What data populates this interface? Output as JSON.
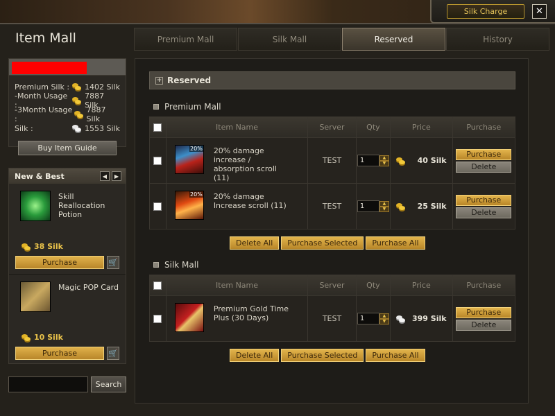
{
  "top": {
    "silk_charge": "Silk Charge",
    "close": "✕"
  },
  "app": {
    "title": "Item Mall"
  },
  "tabs": [
    {
      "label": "Premium Mall",
      "active": false
    },
    {
      "label": "Silk Mall",
      "active": false
    },
    {
      "label": "Reserved",
      "active": true
    },
    {
      "label": "History",
      "active": false
    }
  ],
  "account": {
    "rows": [
      {
        "label": "Premium Silk :",
        "value": "1402 Silk",
        "coin": "gold"
      },
      {
        "label": "-Month Usage :",
        "value": "7887 Silk",
        "coin": "gold"
      },
      {
        "label": "-3Month Usage :",
        "value": "7887 Silk",
        "coin": "gold"
      },
      {
        "label": "Silk :",
        "value": "1553 Silk",
        "coin": "silver"
      }
    ],
    "guide_button": "Buy Item Guide"
  },
  "new_best": {
    "title": "New & Best",
    "prev": "◀",
    "next": "▶",
    "items": [
      {
        "name": "Skill Reallocation Potion",
        "price": "38 Silk",
        "purchase": "Purchase",
        "icon": "green-orb-icon"
      },
      {
        "name": "Magic POP Card",
        "price": "10 Silk",
        "purchase": "Purchase",
        "icon": "magic-card-icon"
      }
    ],
    "cart": "🛒"
  },
  "search": {
    "placeholder": "",
    "button": "Search"
  },
  "reserved": {
    "header": "Reserved",
    "plus": "+",
    "columns": [
      "Item Name",
      "Server",
      "Qty",
      "Price",
      "Purchase"
    ],
    "premium_section": {
      "title": "Premium Mall",
      "rows": [
        {
          "name": "20% damage increase / absorption scroll (11)",
          "badge": "20%",
          "server": "TEST",
          "qty": "1",
          "price": "40 Silk",
          "coin": "gold",
          "purchase": "Purchase",
          "delete": "Delete"
        },
        {
          "name": "20% damage Increase scroll (11)",
          "badge": "20%",
          "server": "TEST",
          "qty": "1",
          "price": "25 Silk",
          "coin": "gold",
          "purchase": "Purchase",
          "delete": "Delete"
        }
      ]
    },
    "silk_section": {
      "title": "Silk Mall",
      "rows": [
        {
          "name": "Premium Gold Time Plus (30 Days)",
          "badge": "",
          "server": "TEST",
          "qty": "1",
          "price": "399 Silk",
          "coin": "silver",
          "purchase": "Purchase",
          "delete": "Delete"
        }
      ]
    },
    "actions": {
      "delete_all": "Delete All",
      "purchase_selected": "Purchase Selected",
      "purchase_all": "Purchase All"
    }
  },
  "colors": {
    "accent_gold": "#e2b44c",
    "active_tab": "#5a5142",
    "redacted": "#ff0000"
  }
}
